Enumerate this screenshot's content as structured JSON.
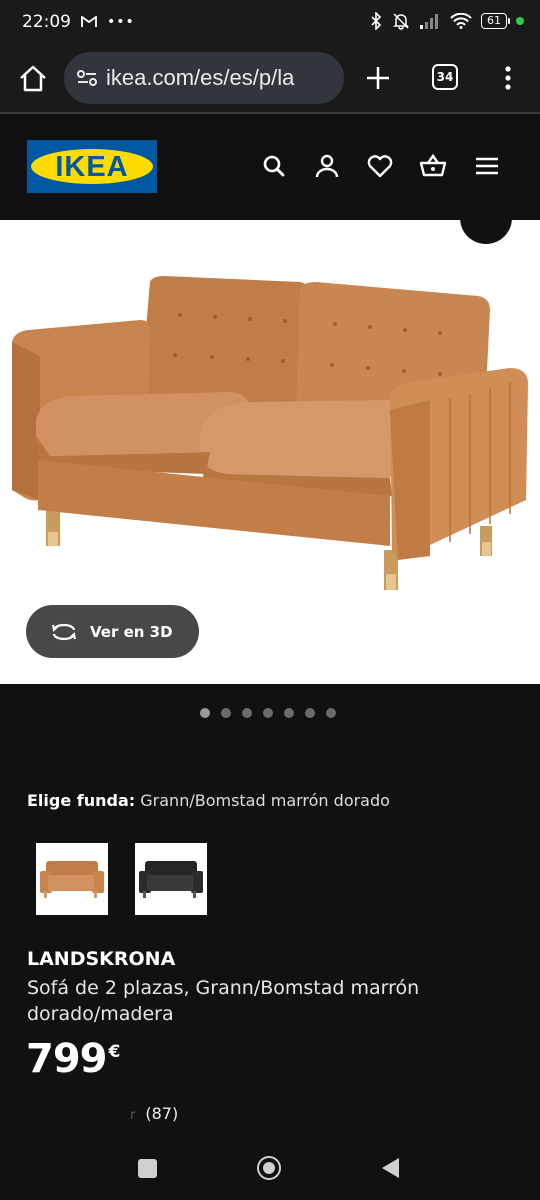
{
  "status_bar": {
    "time": "22:09",
    "notification_icons": [
      "gmail-icon",
      "more-dots-icon"
    ],
    "battery": "61"
  },
  "browser": {
    "url": "ikea.com/es/es/p/la",
    "tab_count": "34"
  },
  "header": {
    "logo_text": "IKEA",
    "icons": [
      "search-icon",
      "account-icon",
      "wishlist-heart-icon",
      "basket-icon",
      "hamburger-menu-icon"
    ]
  },
  "product_media": {
    "view_3d_label": "Ver en 3D",
    "carousel_dot_count": 7,
    "active_dot_index": 0
  },
  "cover_selector": {
    "label": "Elige funda:",
    "selected_value": "Grann/Bomstad marrón dorado"
  },
  "product": {
    "name": "LANDSKRONA",
    "description": "Sofá de 2 plazas, Grann/Bomstad marrón dorado/madera",
    "price": "799",
    "currency": "€",
    "rating_count": "(87)"
  },
  "colors": {
    "sofa_tan": "#c7844f",
    "sofa_black": "#2b2b2b",
    "ikea_blue": "#0058a3",
    "ikea_yellow": "#ffdb00"
  }
}
